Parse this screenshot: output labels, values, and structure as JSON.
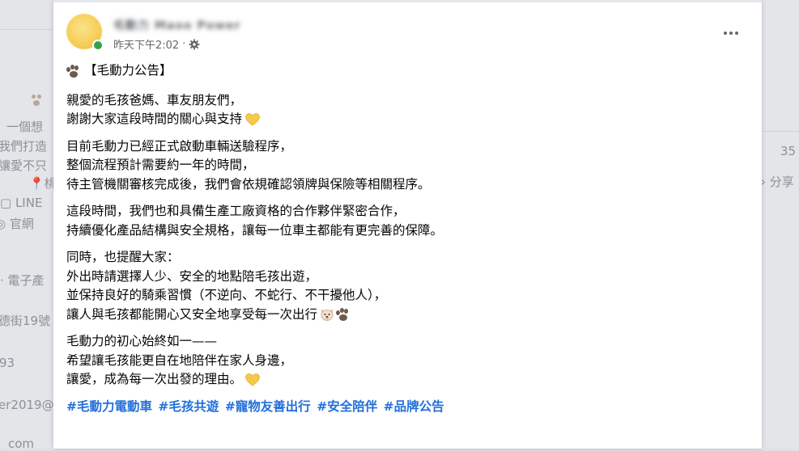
{
  "background": {
    "left_fragments": [
      "一個想",
      "我們打造",
      "讓愛不只",
      "桃",
      "LINE",
      "官網",
      "· 電子產",
      "德街19號",
      "93",
      "er2019@",
      "com"
    ],
    "right_fragments": [
      "35",
      "分享"
    ]
  },
  "post": {
    "author_name": "毛動力 Maoo Power",
    "timestamp": "昨天下午2:02",
    "separator": "·",
    "title": "【毛動力公告】",
    "paragraphs": [
      [
        "親愛的毛孩爸媽、車友朋友們，",
        "謝謝大家這段時間的關心與支持"
      ],
      [
        "目前毛動力已經正式啟動車輛送驗程序，",
        "整個流程預計需要約一年的時間，",
        "待主管機關審核完成後，我們會依規確認領牌與保險等相關程序。"
      ],
      [
        "這段時間，我們也和具備生產工廠資格的合作夥伴緊密合作，",
        "持續優化產品結構與安全規格，讓每一位車主都能有更完善的保障。"
      ],
      [
        "同時，也提醒大家：",
        "外出時請選擇人少、安全的地點陪毛孩出遊，",
        "並保持良好的騎乘習慣（不逆向、不蛇行、不干擾他人），",
        "讓人與毛孩都能開心又安全地享受每一次出行"
      ],
      [
        "毛動力的初心始終如一——",
        "希望讓毛孩能更自在地陪伴在家人身邊，",
        "讓愛，成為每一次出發的理由。"
      ]
    ],
    "hashtags": [
      "#毛動力電動車",
      "#毛孩共遊",
      "#寵物友善出行",
      "#安全陪伴",
      "#品牌公告"
    ],
    "icons": {
      "title": "paw-icon",
      "heart": "yellow-heart-icon",
      "dog": "dog-face-icon",
      "privacy": "gear-icon",
      "menu": "more-options-icon"
    },
    "colors": {
      "hashtag": "#216fdb",
      "heart": "#f7c948",
      "online": "#31a24c",
      "secondary_text": "#65676b"
    }
  }
}
